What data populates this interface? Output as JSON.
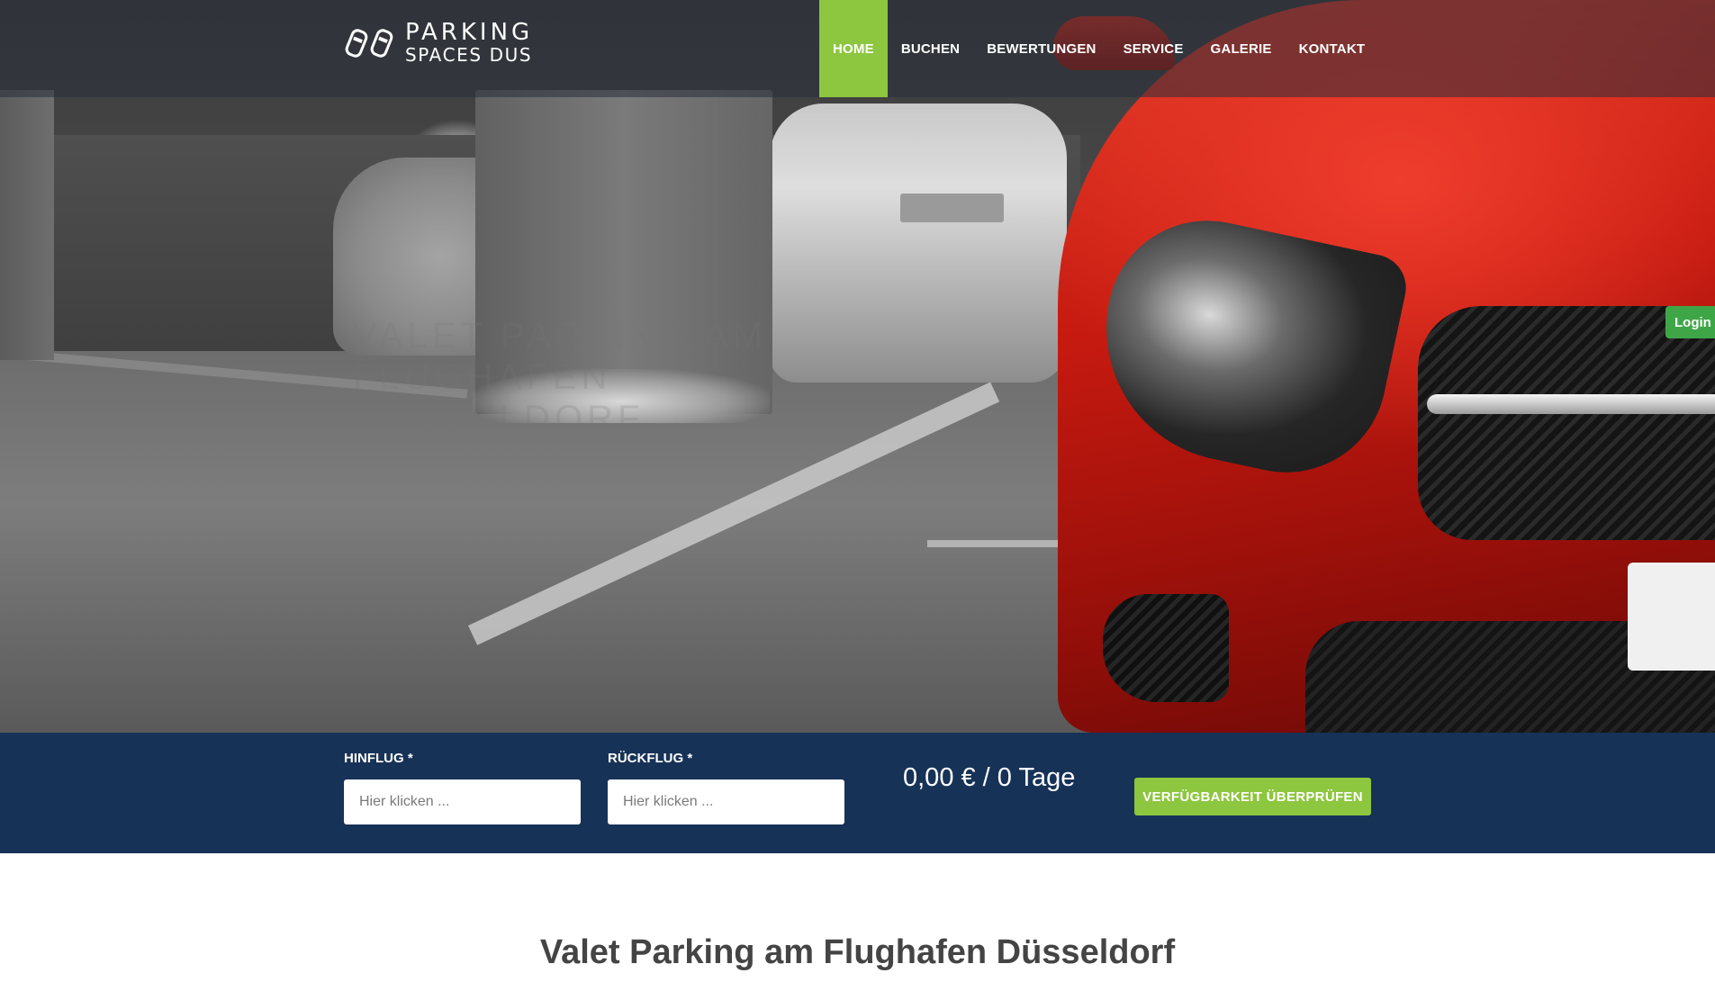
{
  "header": {
    "logo": {
      "line1": "PARKING",
      "line2": "SPACES DUS",
      "icon": "two-cars-icon"
    },
    "nav": [
      {
        "label": "HOME",
        "active": true
      },
      {
        "label": "BUCHEN",
        "active": false
      },
      {
        "label": "BEWERTUNGEN",
        "active": false
      },
      {
        "label": "SERVICE",
        "active": false
      },
      {
        "label": "GALERIE",
        "active": false
      },
      {
        "label": "KONTAKT",
        "active": false
      }
    ]
  },
  "hero": {
    "faded_title_line1": "Valet Parking am Flughafen",
    "faded_title_line2": "Düsseldorf"
  },
  "login_tab": {
    "label": "Login"
  },
  "booking": {
    "outbound": {
      "label": "HINFLUG *",
      "placeholder": "Hier klicken ...",
      "value": ""
    },
    "return": {
      "label": "RÜCKFLUG *",
      "placeholder": "Hier klicken ...",
      "value": ""
    },
    "price": "0,00 € / 0 Tage",
    "check_button": "VERFÜGBARKEIT ÜBERPRÜFEN"
  },
  "main": {
    "headline": "Valet Parking am Flughafen Düsseldorf"
  },
  "colors": {
    "accent_green": "#8dc63f",
    "login_green": "#3fa648",
    "booking_bar_navy": "#173257",
    "headline_text": "#444444"
  }
}
